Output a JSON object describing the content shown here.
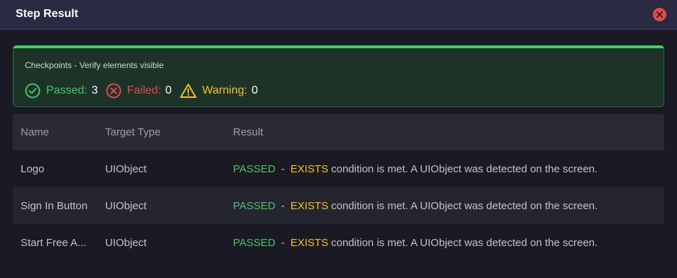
{
  "dialog": {
    "title": "Step Result"
  },
  "summary": {
    "title": "Checkpoints - Verify elements visible",
    "passed_label": "Passed:",
    "passed_count": "3",
    "failed_label": "Failed:",
    "failed_count": "0",
    "warning_label": "Warning:",
    "warning_count": "0"
  },
  "table": {
    "columns": [
      "Name",
      "Target Type",
      "Result"
    ],
    "rows": [
      {
        "name": "Logo",
        "target_type": "UIObject",
        "status": "PASSED",
        "separator": "-",
        "keyword": "EXISTS",
        "message": "condition is met. A UIObject was detected on the screen."
      },
      {
        "name": "Sign In Button",
        "target_type": "UIObject",
        "status": "PASSED",
        "separator": "-",
        "keyword": "EXISTS",
        "message": "condition is met. A UIObject was detected on the screen."
      },
      {
        "name": "Start Free A...",
        "target_type": "UIObject",
        "status": "PASSED",
        "separator": "-",
        "keyword": "EXISTS",
        "message": "condition is met. A UIObject was detected on the screen."
      }
    ]
  },
  "colors": {
    "passed": "#45c567",
    "failed": "#e04a4a",
    "warning": "#f2c318",
    "summary_accent": "#3ecf6a"
  },
  "icons": {
    "close": "close-icon",
    "passed": "check-circle-icon",
    "failed": "x-circle-icon",
    "warning": "warning-triangle-icon"
  }
}
